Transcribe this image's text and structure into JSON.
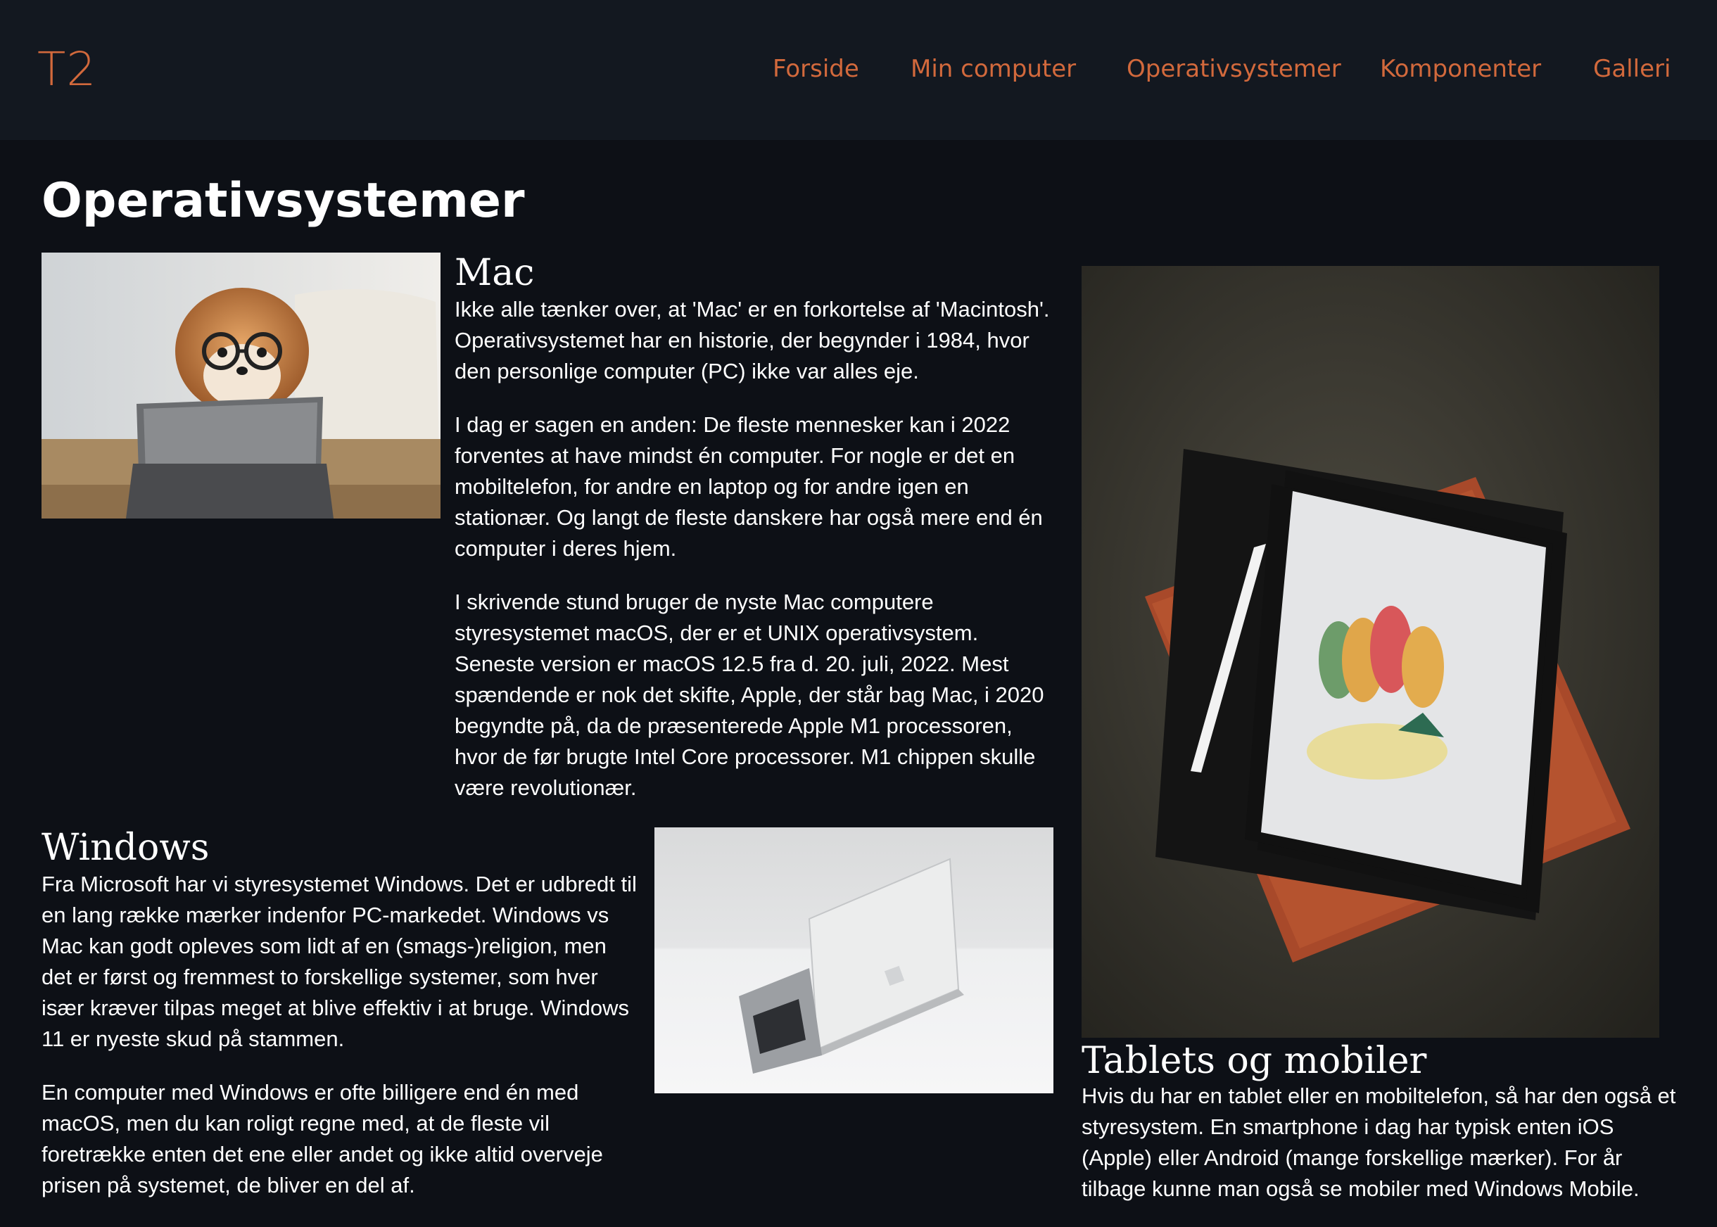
{
  "site": {
    "logo": "T2"
  },
  "nav": {
    "items": [
      {
        "label": "Forside"
      },
      {
        "label": "Min computer"
      },
      {
        "label": "Operativsystemer"
      },
      {
        "label": "Komponenter"
      },
      {
        "label": "Galleri"
      }
    ]
  },
  "page": {
    "title": "Operativsystemer"
  },
  "sections": {
    "mac": {
      "title": "Mac",
      "paragraphs": [
        "Ikke alle tænker over, at 'Mac' er en forkortelse af 'Macintosh'. Operativsystemet har en historie, der begynder i 1984, hvor den personlige computer (PC) ikke var alles eje.",
        "I dag er sagen en anden: De fleste mennesker kan i 2022 forventes at have mindst én computer. For nogle er det en mobiltelefon, for andre en laptop og for andre igen en stationær. Og langt de fleste danskere har også mere end én computer i deres hjem.",
        "I skrivende stund bruger de nyste Mac computere styresystemet macOS, der er et UNIX operativsystem. Seneste version er macOS 12.5 fra d. 20. juli, 2022. Mest spændende er nok det skifte, Apple, der står bag Mac, i 2020 begyndte på, da de præsenterede Apple M1 processoren, hvor de før brugte Intel Core processorer. M1 chippen skulle være revolutionær."
      ]
    },
    "windows": {
      "title": "Windows",
      "paragraphs": [
        "Fra Microsoft har vi styresystemet Windows. Det er udbredt til en lang række mærker indenfor PC-markedet. Windows vs Mac kan godt opleves som lidt af en (smags-)religion, men det er først og fremmest to forskellige systemer, som hver især kræver tilpas meget at blive effektiv i at bruge. Windows 11 er nyeste skud på stammen.",
        "En computer med Windows er ofte billigere end én med macOS, men du kan roligt regne med, at de fleste vil foretrække enten det ene eller andet og ikke altid overveje prisen på systemet, de bliver en del af."
      ]
    },
    "tablets": {
      "title": "Tablets og mobiler",
      "paragraphs": [
        "Hvis du har en tablet eller en mobiltelefon, så har den også et styresystem. En smartphone i dag har typisk enten iOS (Apple) eller Android (mange forskellige mærker). For år tilbage kunne man også se mobiler med Windows Mobile."
      ]
    }
  },
  "colors": {
    "accent": "#d2693c",
    "navbar_bg": "#131820",
    "page_bg": "#0d1016",
    "text": "#ffffff"
  }
}
